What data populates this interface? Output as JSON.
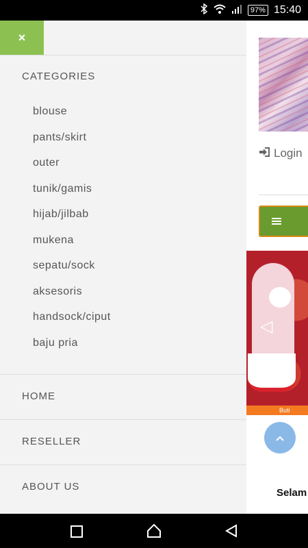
{
  "status_bar": {
    "battery": "97%",
    "time": "15:40",
    "icons": [
      "bluetooth-icon",
      "wifi-icon",
      "signal-icon",
      "battery-icon"
    ]
  },
  "drawer": {
    "close_icon": "×",
    "categories_title": "CATEGORIES",
    "categories": [
      "blouse",
      "pants/skirt",
      "outer",
      "tunik/gamis",
      "hijab/jilbab",
      "mukena",
      "sepatu/sock",
      "aksesoris",
      "handsock/ciput",
      "baju pria"
    ],
    "nav": [
      "HOME",
      "RESELLER",
      "ABOUT US"
    ]
  },
  "page": {
    "login_label": "Login",
    "banner_footer": "Buti",
    "welcome_text": "Selam"
  },
  "colors": {
    "drawer_bg": "#f3f3f3",
    "close_button": "#8cc152",
    "menu_toggle": "#6a9b2f",
    "menu_toggle_border": "#d98a14",
    "scroll_top_button": "#8ab9e8"
  }
}
